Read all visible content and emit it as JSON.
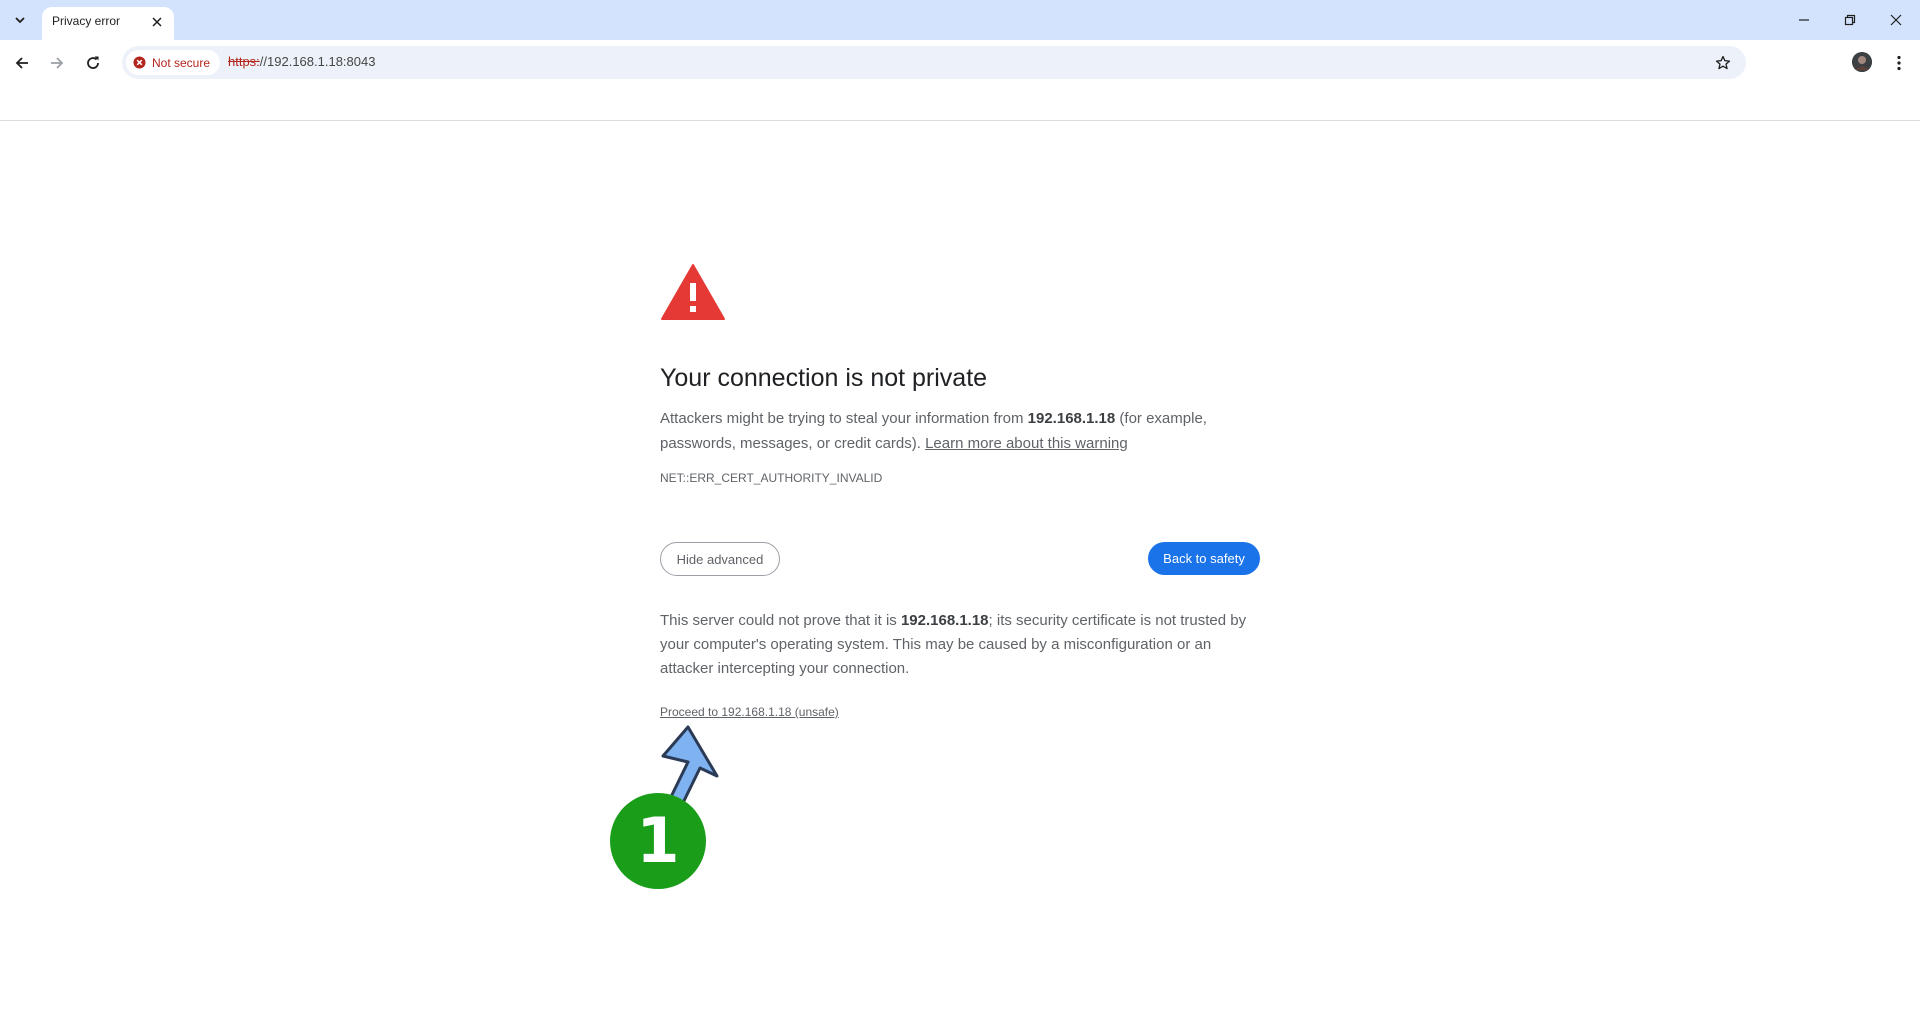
{
  "browser": {
    "tab": {
      "title": "Privacy error"
    },
    "address_bar": {
      "security_label": "Not secure",
      "url_scheme": "https:",
      "url_rest": "//192.168.1.18:8043"
    },
    "icons": {
      "tab_search": "chevron-down-icon",
      "tab_close": "close-icon",
      "back": "arrow-left-icon",
      "forward": "arrow-right-icon",
      "reload": "reload-icon",
      "security": "error-icon",
      "bookmark": "star-icon",
      "menu": "kebab-icon"
    },
    "colors": {
      "tabstrip": "#d3e3fd",
      "omnibox": "#edf2fa",
      "danger": "#b3261e"
    }
  },
  "interstitial": {
    "heading": "Your connection is not private",
    "explanation": {
      "before": "Attackers might be trying to steal your information from ",
      "host": "192.168.1.18",
      "after": " (for example, passwords, messages, or credit cards). ",
      "learn_more": "Learn more about this warning"
    },
    "error_code": "NET::ERR_CERT_AUTHORITY_INVALID",
    "hide_advanced_label": "Hide advanced",
    "back_to_safety_label": "Back to safety",
    "details": {
      "before": "This server could not prove that it is ",
      "host": "192.168.1.18",
      "after": "; its security certificate is not trusted by your computer's operating system. This may be caused by a misconfiguration or an attacker intercepting your connection."
    },
    "proceed_link": "Proceed to 192.168.1.18 (unsafe)",
    "colors": {
      "warning": "#e53935",
      "primary_button": "#1a73e8"
    }
  },
  "annotation": {
    "step_number": "1",
    "colors": {
      "badge": "#1a9e1a",
      "arrow_fill": "#7fb2f0",
      "arrow_stroke": "#2b3a55"
    }
  }
}
